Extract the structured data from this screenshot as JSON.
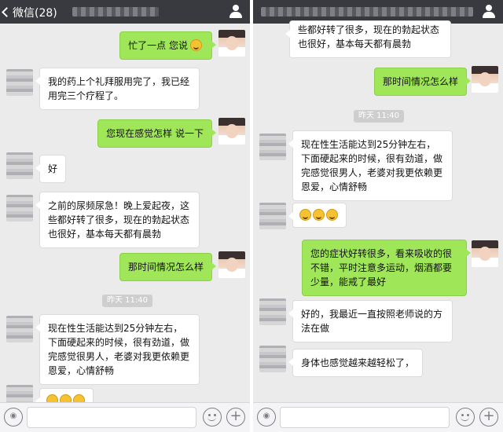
{
  "left": {
    "back_label": "微信(28)",
    "messages": [
      {
        "side": "right",
        "text": "忙了一点 您说",
        "emoji": 1
      },
      {
        "side": "left",
        "text": "我的药上个礼拜服用完了，我已经用完三个疗程了。"
      },
      {
        "side": "right",
        "text": "您现在感觉怎样 说一下"
      },
      {
        "side": "left",
        "text": "好"
      },
      {
        "side": "left",
        "text": "之前的尿频尿急！晚上爱起夜，这些都好转了很多，现在的勃起状态也很好，基本每天都有晨勃"
      },
      {
        "side": "right",
        "text": "那时间情况怎么样"
      },
      {
        "time": "昨天 11:40"
      },
      {
        "side": "left",
        "text": "现在性生活能达到25分钟左右，下面硬起来的时候，很有劲道，做完感觉很男人，老婆对我更依赖更恩爱，心情舒畅"
      },
      {
        "side": "left",
        "text": "",
        "emoji": 3
      }
    ]
  },
  "right": {
    "messages": [
      {
        "side": "left",
        "text": "些都好转了很多，现在的勃起状态也很好，基本每天都有晨勃"
      },
      {
        "side": "right",
        "text": "那时间情况怎么样"
      },
      {
        "time": "昨天 11:40"
      },
      {
        "side": "left",
        "text": "现在性生活能达到25分钟左右，下面硬起来的时候，很有劲道，做完感觉很男人，老婆对我更依赖更恩爱，心情舒畅"
      },
      {
        "side": "left",
        "text": "",
        "emoji": 3
      },
      {
        "side": "right",
        "text": "您的症状好转很多，看来吸收的很不错，平时注意多运动，烟酒都要少量，能戒了最好"
      },
      {
        "side": "left",
        "text": "好的，我最近一直按照老师说的方法在做"
      },
      {
        "side": "left",
        "text": "身体也感觉越来越轻松了，"
      }
    ]
  },
  "colors": {
    "topbar": "#393a3f",
    "chat_background": "#ebebeb",
    "sent_bubble": "#9fe658",
    "received_bubble": "#ffffff"
  }
}
